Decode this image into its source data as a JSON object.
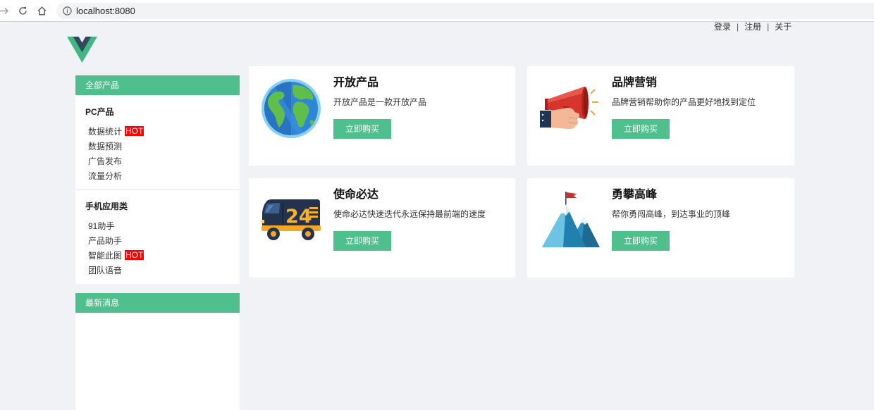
{
  "browser": {
    "url": "localhost:8080",
    "icons": {
      "forward": "forward-arrow-icon",
      "reload": "reload-icon",
      "home": "home-icon",
      "site_info": "info-icon"
    }
  },
  "header": {
    "logo": "vue-logo-icon",
    "links": [
      {
        "label": "登录"
      },
      {
        "label": "注册"
      },
      {
        "label": "关于"
      }
    ],
    "separator": "|"
  },
  "sidebar": {
    "all_products": {
      "title": "全部产品",
      "groups": [
        {
          "title": "PC产品",
          "items": [
            {
              "label": "数据统计",
              "badge": "HOT"
            },
            {
              "label": "数据预测"
            },
            {
              "label": "广告发布"
            },
            {
              "label": "流量分析"
            }
          ]
        },
        {
          "title": "手机应用类",
          "items": [
            {
              "label": "91助手"
            },
            {
              "label": "产品助手"
            },
            {
              "label": "智能此图",
              "badge": "HOT"
            },
            {
              "label": "团队语音"
            }
          ]
        }
      ]
    },
    "news": {
      "title": "最新消息"
    }
  },
  "products": [
    {
      "title": "开放产品",
      "description": "开放产品是一款开放产品",
      "button": "立即购买",
      "icon": "globe-icon"
    },
    {
      "title": "品牌营销",
      "description": "品牌营销帮助你的产品更好地找到定位",
      "button": "立即购买",
      "icon": "megaphone-icon"
    },
    {
      "title": "使命必达",
      "description": "使命必达快速迭代永远保持最前端的速度",
      "button": "立即购买",
      "icon": "delivery-truck-icon",
      "icon_text": "24"
    },
    {
      "title": "勇攀高峰",
      "description": "帮你勇闯高峰，到达事业的顶峰",
      "button": "立即购买",
      "icon": "mountain-flag-icon"
    }
  ],
  "colors": {
    "accent": "#4fc08d",
    "hot_badge": "#ff0000",
    "page_background": "#f1f2f5",
    "panel": "#ffffff"
  }
}
